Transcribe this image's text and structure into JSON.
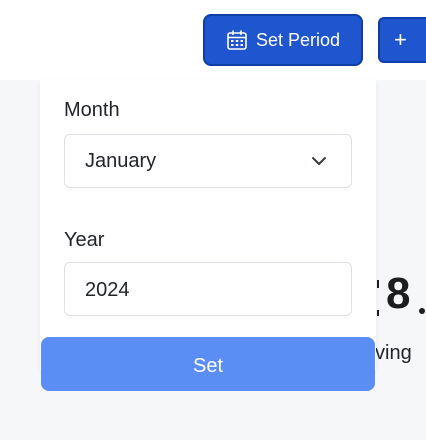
{
  "toolbar": {
    "set_period_label": "Set Period",
    "set_period_icon": "calendar-icon",
    "add_icon": "plus-icon",
    "add_label": "+",
    "accent_color": "#1f56cf"
  },
  "period_form": {
    "month_label": "Month",
    "month_value": "January",
    "month_dropdown_icon": "chevron-down-icon",
    "year_label": "Year",
    "year_value": "2024",
    "set_button_label": "Set",
    "set_button_color": "#5b8ef5"
  },
  "background": {
    "partial_number": "8",
    "partial_word": "ving"
  }
}
